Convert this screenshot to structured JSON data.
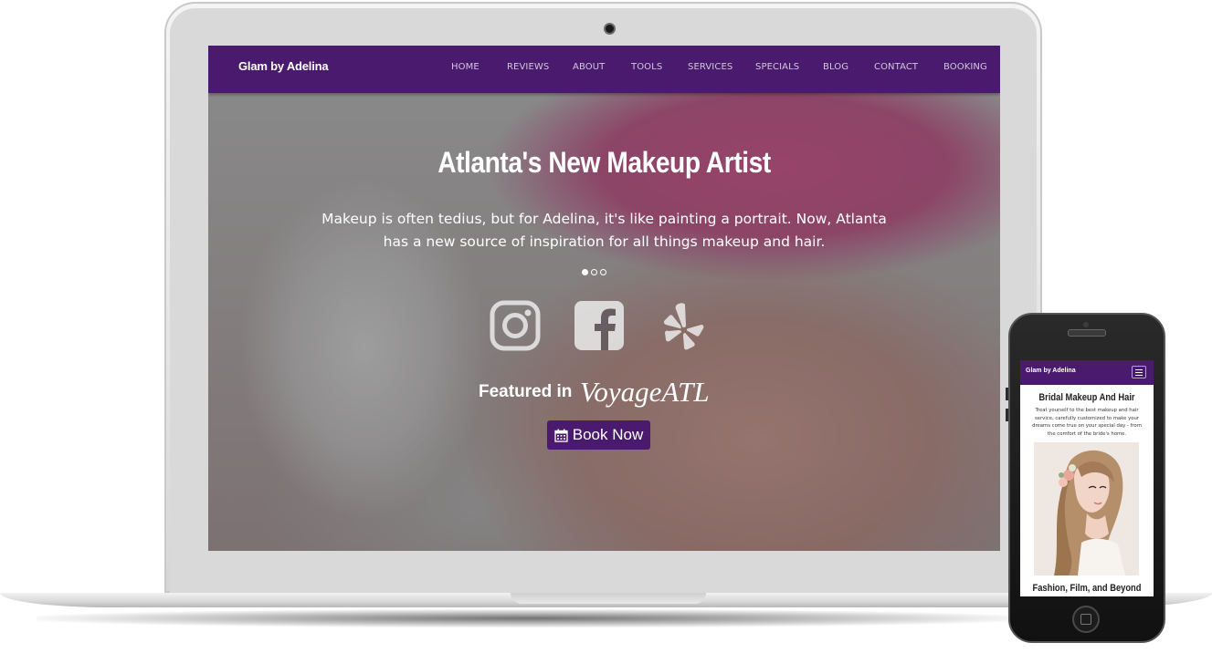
{
  "laptop": {
    "navbar": {
      "brand": "Glam by Adelina",
      "items": [
        "HOME",
        "REVIEWS",
        "ABOUT",
        "TOOLS",
        "SERVICES",
        "SPECIALS",
        "BLOG",
        "CONTACT",
        "BOOKING"
      ]
    },
    "hero": {
      "title": "Atlanta's New Makeup Artist",
      "text": "Makeup is often tedius, but for Adelina, it's like painting a portrait. Now, Atlanta has a new source of inspiration for all things makeup and hair.",
      "slides_total": 3,
      "slide_active": 1,
      "social": [
        "instagram-icon",
        "facebook-icon",
        "yelp-icon"
      ],
      "featured_label": "Featured in",
      "featured_brand": "VoyageATL",
      "book_label": "Book Now",
      "book_icon": "calendar-icon"
    },
    "colors": {
      "nav_bg": "#4a1a6e",
      "nav_text": "#d3c7db",
      "button_bg": "#4a1a6e"
    }
  },
  "phone": {
    "navbar": {
      "brand": "Glam by Adelina",
      "menu_icon": "hamburger-icon"
    },
    "section1": {
      "title": "Bridal Makeup And Hair",
      "text": "Treat yourself to the best makeup and hair service, carefully customized to make your dreams come true on your special day - from the comfort of the bride's home."
    },
    "section2": {
      "title": "Fashion, Film, and Beyond"
    }
  }
}
